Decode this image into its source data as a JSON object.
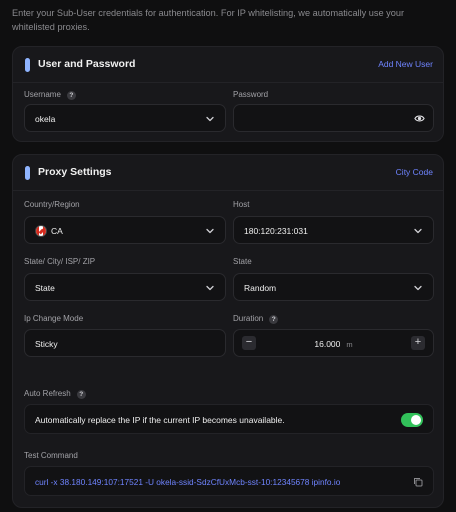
{
  "intro_text": "Enter your Sub-User credentials for authentication. For IP whitelisting, we automatically use your whitelisted proxies.",
  "user_section": {
    "title": "User and Password",
    "add_link": "Add New User",
    "username_label": "Username",
    "username_value": "okela",
    "password_label": "Password",
    "password_value": ""
  },
  "proxy_section": {
    "title": "Proxy Settings",
    "city_code_link": "City Code",
    "country_label": "Country/Region",
    "country_value": "CA",
    "host_label": "Host",
    "host_value": "180:120:231:031",
    "state_city_label": "State/ City/ ISP/ ZIP",
    "state_city_value": "State",
    "state_label": "State",
    "state_value": "Random",
    "ip_change_label": "Ip Change Mode",
    "ip_change_value": "Sticky",
    "duration_label": "Duration",
    "duration_value": "16.000",
    "duration_unit": "m",
    "auto_refresh_label": "Auto Refresh",
    "auto_refresh_text": "Automatically replace the IP if the current IP becomes unavailable.",
    "auto_refresh_on": true,
    "test_command_label": "Test Command",
    "test_command": "curl -x 38.180.149:107:17521 -U okela-ssid-SdzCfUxMcb-sst-10:12345678 ipinfo.io"
  },
  "colors": {
    "accent": "#8fb4ff",
    "link": "#6f84ff",
    "toggle_on": "#32c15a"
  },
  "icons": [
    "chevron-down-icon",
    "eye-icon",
    "help-icon",
    "ca-flag-icon",
    "minus-icon",
    "plus-icon",
    "copy-icon"
  ]
}
